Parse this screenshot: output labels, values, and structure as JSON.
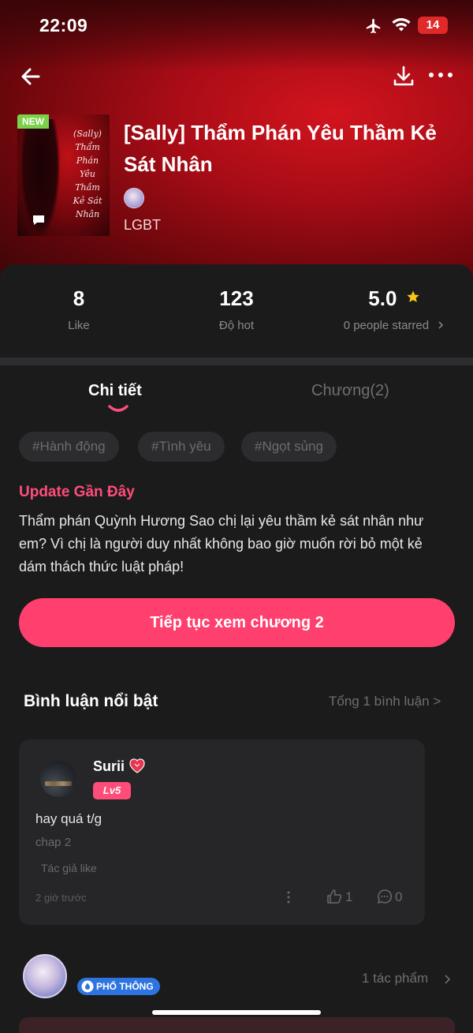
{
  "status_bar": {
    "time": "22:09",
    "battery": "14",
    "icons": [
      "airplane-icon",
      "wifi-icon",
      "battery-icon"
    ]
  },
  "nav": {
    "icons": [
      "back-arrow-icon",
      "download-icon",
      "more-icon"
    ]
  },
  "book": {
    "badge": "NEW",
    "cover_text": [
      "(Sally)",
      "Thẩm",
      "Phán",
      "Yêu",
      "Thầm",
      "Kẻ Sát",
      "Nhân"
    ],
    "title": "[Sally] Thẩm Phán Yêu Thầm Kẻ Sát Nhân",
    "genre": "LGBT"
  },
  "stats": {
    "likes": {
      "value": "8",
      "label": "Like"
    },
    "hot": {
      "value": "123",
      "label": "Độ hot"
    },
    "rating": {
      "value": "5.0",
      "label": "0 people starred"
    }
  },
  "tabs": {
    "detail": "Chi tiết",
    "chapters": "Chương(2)"
  },
  "tags": [
    "#Hành động",
    "#Tình yêu",
    "#Ngọt sủng"
  ],
  "update": {
    "heading": "Update Gần Đây",
    "text": "Thẩm phán Quỳnh Hương  Sao chị lại yêu thầm kẻ sát nhân như em?  Vì chị là người duy nhất không bao giờ muốn rời bỏ một kẻ dám thách thức luật pháp!"
  },
  "cta": {
    "label": "Tiếp tục xem chương 2"
  },
  "comments": {
    "heading": "Bình luận nổi bật",
    "total": "Tổng 1 bình luận >",
    "items": [
      {
        "user": "Surii",
        "level": "Lv5",
        "text": "hay quá t/g",
        "chapter": "chap 2",
        "author_like": "Tác giả like",
        "time": "2 giờ trước",
        "likes": "1",
        "replies": "0"
      }
    ]
  },
  "author": {
    "badge": "PHỔ THÔNG",
    "works": "1 tác phẩm"
  },
  "colors": {
    "accent": "#ff3f6e",
    "accent_text": "#ff4d7a",
    "background": "#1b1b1c",
    "star": "#f5c518",
    "hero_red": "#c8141c"
  }
}
